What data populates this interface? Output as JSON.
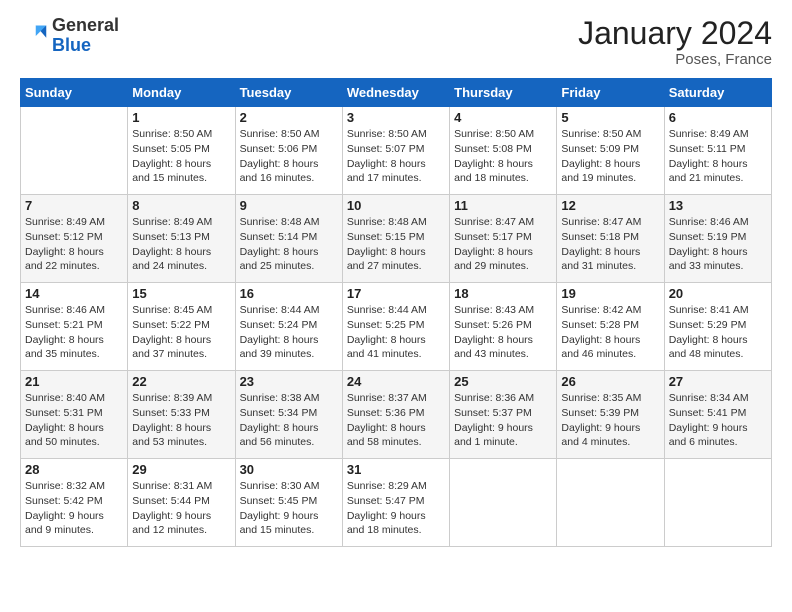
{
  "header": {
    "logo": {
      "line1": "General",
      "line2": "Blue"
    },
    "title": "January 2024",
    "location": "Poses, France"
  },
  "weekdays": [
    "Sunday",
    "Monday",
    "Tuesday",
    "Wednesday",
    "Thursday",
    "Friday",
    "Saturday"
  ],
  "weeks": [
    [
      {
        "day": "",
        "sunrise": "",
        "sunset": "",
        "daylight": ""
      },
      {
        "day": "1",
        "sunrise": "Sunrise: 8:50 AM",
        "sunset": "Sunset: 5:05 PM",
        "daylight": "Daylight: 8 hours and 15 minutes."
      },
      {
        "day": "2",
        "sunrise": "Sunrise: 8:50 AM",
        "sunset": "Sunset: 5:06 PM",
        "daylight": "Daylight: 8 hours and 16 minutes."
      },
      {
        "day": "3",
        "sunrise": "Sunrise: 8:50 AM",
        "sunset": "Sunset: 5:07 PM",
        "daylight": "Daylight: 8 hours and 17 minutes."
      },
      {
        "day": "4",
        "sunrise": "Sunrise: 8:50 AM",
        "sunset": "Sunset: 5:08 PM",
        "daylight": "Daylight: 8 hours and 18 minutes."
      },
      {
        "day": "5",
        "sunrise": "Sunrise: 8:50 AM",
        "sunset": "Sunset: 5:09 PM",
        "daylight": "Daylight: 8 hours and 19 minutes."
      },
      {
        "day": "6",
        "sunrise": "Sunrise: 8:49 AM",
        "sunset": "Sunset: 5:11 PM",
        "daylight": "Daylight: 8 hours and 21 minutes."
      }
    ],
    [
      {
        "day": "7",
        "sunrise": "Sunrise: 8:49 AM",
        "sunset": "Sunset: 5:12 PM",
        "daylight": "Daylight: 8 hours and 22 minutes."
      },
      {
        "day": "8",
        "sunrise": "Sunrise: 8:49 AM",
        "sunset": "Sunset: 5:13 PM",
        "daylight": "Daylight: 8 hours and 24 minutes."
      },
      {
        "day": "9",
        "sunrise": "Sunrise: 8:48 AM",
        "sunset": "Sunset: 5:14 PM",
        "daylight": "Daylight: 8 hours and 25 minutes."
      },
      {
        "day": "10",
        "sunrise": "Sunrise: 8:48 AM",
        "sunset": "Sunset: 5:15 PM",
        "daylight": "Daylight: 8 hours and 27 minutes."
      },
      {
        "day": "11",
        "sunrise": "Sunrise: 8:47 AM",
        "sunset": "Sunset: 5:17 PM",
        "daylight": "Daylight: 8 hours and 29 minutes."
      },
      {
        "day": "12",
        "sunrise": "Sunrise: 8:47 AM",
        "sunset": "Sunset: 5:18 PM",
        "daylight": "Daylight: 8 hours and 31 minutes."
      },
      {
        "day": "13",
        "sunrise": "Sunrise: 8:46 AM",
        "sunset": "Sunset: 5:19 PM",
        "daylight": "Daylight: 8 hours and 33 minutes."
      }
    ],
    [
      {
        "day": "14",
        "sunrise": "Sunrise: 8:46 AM",
        "sunset": "Sunset: 5:21 PM",
        "daylight": "Daylight: 8 hours and 35 minutes."
      },
      {
        "day": "15",
        "sunrise": "Sunrise: 8:45 AM",
        "sunset": "Sunset: 5:22 PM",
        "daylight": "Daylight: 8 hours and 37 minutes."
      },
      {
        "day": "16",
        "sunrise": "Sunrise: 8:44 AM",
        "sunset": "Sunset: 5:24 PM",
        "daylight": "Daylight: 8 hours and 39 minutes."
      },
      {
        "day": "17",
        "sunrise": "Sunrise: 8:44 AM",
        "sunset": "Sunset: 5:25 PM",
        "daylight": "Daylight: 8 hours and 41 minutes."
      },
      {
        "day": "18",
        "sunrise": "Sunrise: 8:43 AM",
        "sunset": "Sunset: 5:26 PM",
        "daylight": "Daylight: 8 hours and 43 minutes."
      },
      {
        "day": "19",
        "sunrise": "Sunrise: 8:42 AM",
        "sunset": "Sunset: 5:28 PM",
        "daylight": "Daylight: 8 hours and 46 minutes."
      },
      {
        "day": "20",
        "sunrise": "Sunrise: 8:41 AM",
        "sunset": "Sunset: 5:29 PM",
        "daylight": "Daylight: 8 hours and 48 minutes."
      }
    ],
    [
      {
        "day": "21",
        "sunrise": "Sunrise: 8:40 AM",
        "sunset": "Sunset: 5:31 PM",
        "daylight": "Daylight: 8 hours and 50 minutes."
      },
      {
        "day": "22",
        "sunrise": "Sunrise: 8:39 AM",
        "sunset": "Sunset: 5:33 PM",
        "daylight": "Daylight: 8 hours and 53 minutes."
      },
      {
        "day": "23",
        "sunrise": "Sunrise: 8:38 AM",
        "sunset": "Sunset: 5:34 PM",
        "daylight": "Daylight: 8 hours and 56 minutes."
      },
      {
        "day": "24",
        "sunrise": "Sunrise: 8:37 AM",
        "sunset": "Sunset: 5:36 PM",
        "daylight": "Daylight: 8 hours and 58 minutes."
      },
      {
        "day": "25",
        "sunrise": "Sunrise: 8:36 AM",
        "sunset": "Sunset: 5:37 PM",
        "daylight": "Daylight: 9 hours and 1 minute."
      },
      {
        "day": "26",
        "sunrise": "Sunrise: 8:35 AM",
        "sunset": "Sunset: 5:39 PM",
        "daylight": "Daylight: 9 hours and 4 minutes."
      },
      {
        "day": "27",
        "sunrise": "Sunrise: 8:34 AM",
        "sunset": "Sunset: 5:41 PM",
        "daylight": "Daylight: 9 hours and 6 minutes."
      }
    ],
    [
      {
        "day": "28",
        "sunrise": "Sunrise: 8:32 AM",
        "sunset": "Sunset: 5:42 PM",
        "daylight": "Daylight: 9 hours and 9 minutes."
      },
      {
        "day": "29",
        "sunrise": "Sunrise: 8:31 AM",
        "sunset": "Sunset: 5:44 PM",
        "daylight": "Daylight: 9 hours and 12 minutes."
      },
      {
        "day": "30",
        "sunrise": "Sunrise: 8:30 AM",
        "sunset": "Sunset: 5:45 PM",
        "daylight": "Daylight: 9 hours and 15 minutes."
      },
      {
        "day": "31",
        "sunrise": "Sunrise: 8:29 AM",
        "sunset": "Sunset: 5:47 PM",
        "daylight": "Daylight: 9 hours and 18 minutes."
      },
      {
        "day": "",
        "sunrise": "",
        "sunset": "",
        "daylight": ""
      },
      {
        "day": "",
        "sunrise": "",
        "sunset": "",
        "daylight": ""
      },
      {
        "day": "",
        "sunrise": "",
        "sunset": "",
        "daylight": ""
      }
    ]
  ]
}
